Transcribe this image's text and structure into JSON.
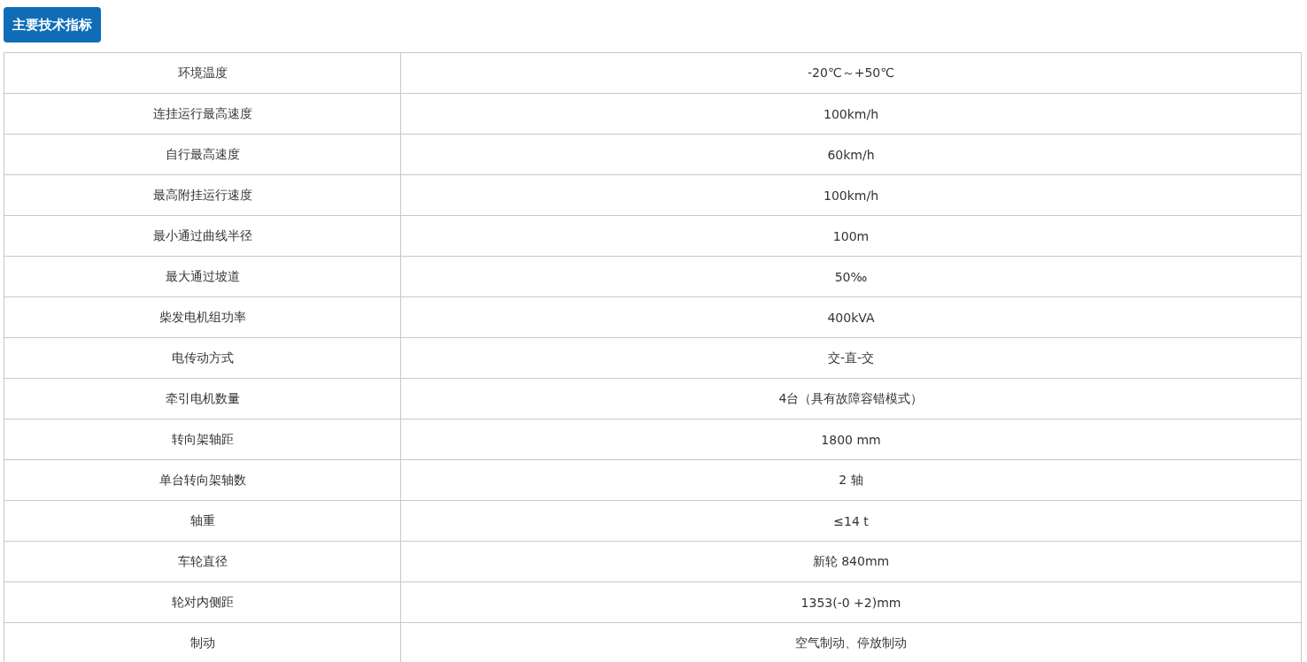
{
  "section_button": "主要技术指标",
  "specs": [
    {
      "name": "环境温度",
      "value": "-20℃～+50℃"
    },
    {
      "name": "连挂运行最高速度",
      "value": "100km/h"
    },
    {
      "name": "自行最高速度",
      "value": "60km/h"
    },
    {
      "name": "最高附挂运行速度",
      "value": "100km/h"
    },
    {
      "name": "最小通过曲线半径",
      "value": "100m"
    },
    {
      "name": "最大通过坡道",
      "value": "50‰"
    },
    {
      "name": "柴发电机组功率",
      "value": "400kVA"
    },
    {
      "name": "电传动方式",
      "value": "交-直-交"
    },
    {
      "name": "牵引电机数量",
      "value": "4台（具有故障容错模式）"
    },
    {
      "name": "转向架轴距",
      "value": "1800 mm"
    },
    {
      "name": "单台转向架轴数",
      "value": "2 轴"
    },
    {
      "name": "轴重",
      "value": "≤14 t"
    },
    {
      "name": "车轮直径",
      "value": "新轮 840mm"
    },
    {
      "name": "轮对内侧距",
      "value": "1353(-0 +2)mm"
    },
    {
      "name": "制动",
      "value": "空气制动、停放制动"
    }
  ]
}
